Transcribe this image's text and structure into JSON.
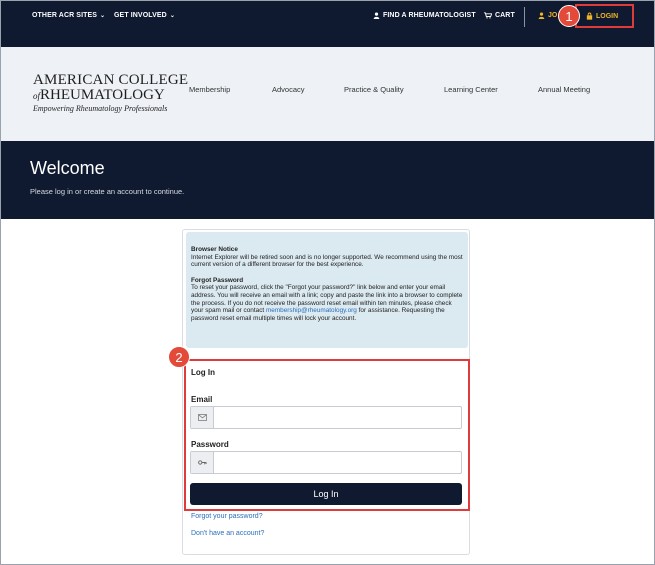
{
  "topbar": {
    "other_sites": "OTHER ACR SITES",
    "get_involved": "GET INVOLVED",
    "find_rheumatologist": "FIND A RHEUMATOLOGIST",
    "cart": "CART",
    "join": "JO",
    "login": "LOGIN"
  },
  "callouts": {
    "one": "1",
    "two": "2"
  },
  "logo": {
    "line1": "AMERICAN COLLEGE",
    "line2_of": "of",
    "line2": "RHEUMATOLOGY",
    "tagline": "Empowering Rheumatology Professionals"
  },
  "nav": {
    "membership": "Membership",
    "advocacy": "Advocacy",
    "practice_quality": "Practice & Quality",
    "learning_center": "Learning Center",
    "annual_meeting": "Annual Meeting"
  },
  "welcome": {
    "title": "Welcome",
    "subtitle": "Please log in or create an account to continue."
  },
  "notice": {
    "browser_title": "Browser Notice",
    "browser_text": "Internet Explorer will be retired soon and is no longer supported. We recommend using the most current version of a different browser for the best experience.",
    "forgot_title": "Forgot Password",
    "forgot_text_1": "To reset your password, click the \"Forgot your password?\" link below and enter your email address. You will receive an email with a link; copy and paste the link into a browser to complete the process. If you do not receive the password reset email within ten minutes, please check your spam mail or contact",
    "forgot_email": "membership@rheumatology.org",
    "forgot_text_2": "for assistance. Requesting the password reset email multiple times will lock your account."
  },
  "login_form": {
    "title": "Log In",
    "email_label": "Email",
    "email_value": "",
    "password_label": "Password",
    "password_value": "",
    "submit_label": "Log In",
    "forgot_link": "Forgot your password?",
    "no_account_link": "Don't have an account?"
  },
  "colors": {
    "navy": "#0f1a30",
    "gold": "#f0b429",
    "callout_red": "#e03b3b",
    "link_blue": "#2a6ebb",
    "notice_bg": "#dbe9f0"
  },
  "icons": {
    "user": "user-icon",
    "cart": "cart-icon",
    "lock": "lock-icon",
    "envelope": "envelope-icon",
    "key": "key-icon",
    "chevron": "chevron-down-icon"
  }
}
